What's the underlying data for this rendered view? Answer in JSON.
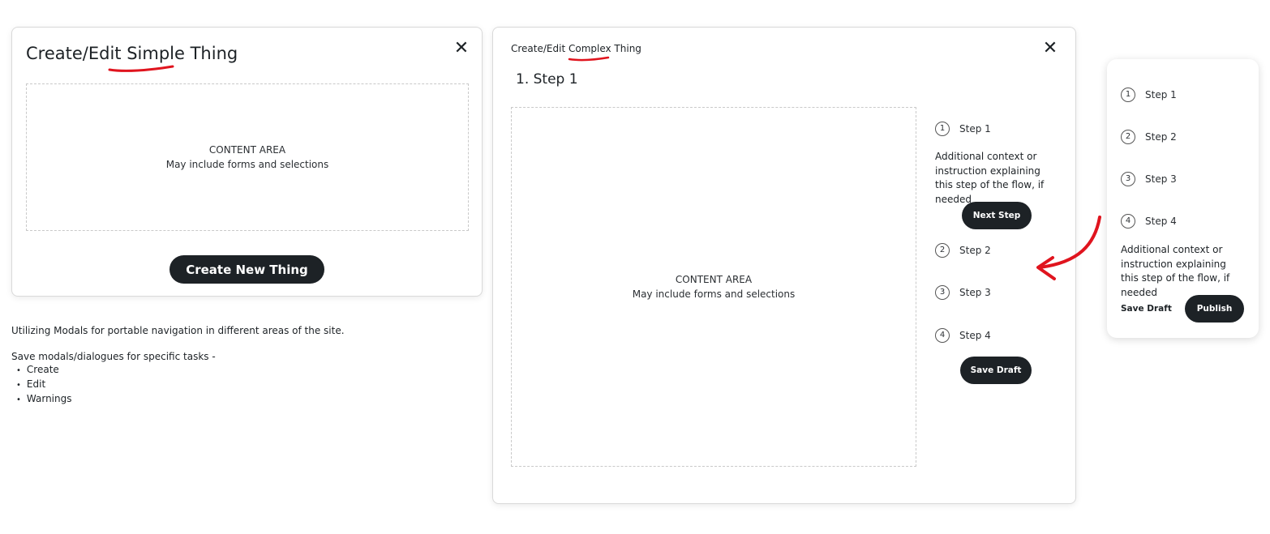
{
  "simple_modal": {
    "title_prefix": "Create/Edit ",
    "title_highlight": "Simple",
    "title_suffix": " Thing",
    "close_label": "✕",
    "content_title": "CONTENT AREA",
    "content_subtitle": "May include forms and selections",
    "primary_button": "Create New Thing"
  },
  "notes": {
    "intro": "Utilizing Modals for portable navigation in different areas of the site.",
    "list_heading": "Save modals/dialogues for specific tasks -",
    "items": [
      "Create",
      "Edit",
      "Warnings"
    ]
  },
  "complex_modal": {
    "title_prefix": "Create/Edit ",
    "title_highlight": "Complex",
    "title_suffix": " Thing",
    "close_label": "✕",
    "step_heading": "1. Step 1",
    "content_title": "CONTENT AREA",
    "content_subtitle": "May include forms and selections",
    "steps": [
      {
        "num": "1",
        "label": "Step 1"
      },
      {
        "num": "2",
        "label": "Step 2"
      },
      {
        "num": "3",
        "label": "Step 3"
      },
      {
        "num": "4",
        "label": "Step 4"
      }
    ],
    "context": "Additional context or instruction explaining this step of the flow, if needed",
    "next_button": "Next Step",
    "save_draft_button": "Save Draft"
  },
  "side_panel": {
    "steps": [
      {
        "num": "1",
        "label": "Step 1"
      },
      {
        "num": "2",
        "label": "Step 2"
      },
      {
        "num": "3",
        "label": "Step 3"
      },
      {
        "num": "4",
        "label": "Step 4"
      }
    ],
    "context": "Additional context or instruction explaining this step of the flow, if needed",
    "save_draft_link": "Save Draft",
    "publish_button": "Publish"
  },
  "colors": {
    "accent_red": "#e0141e",
    "button_dark": "#1d2226"
  }
}
